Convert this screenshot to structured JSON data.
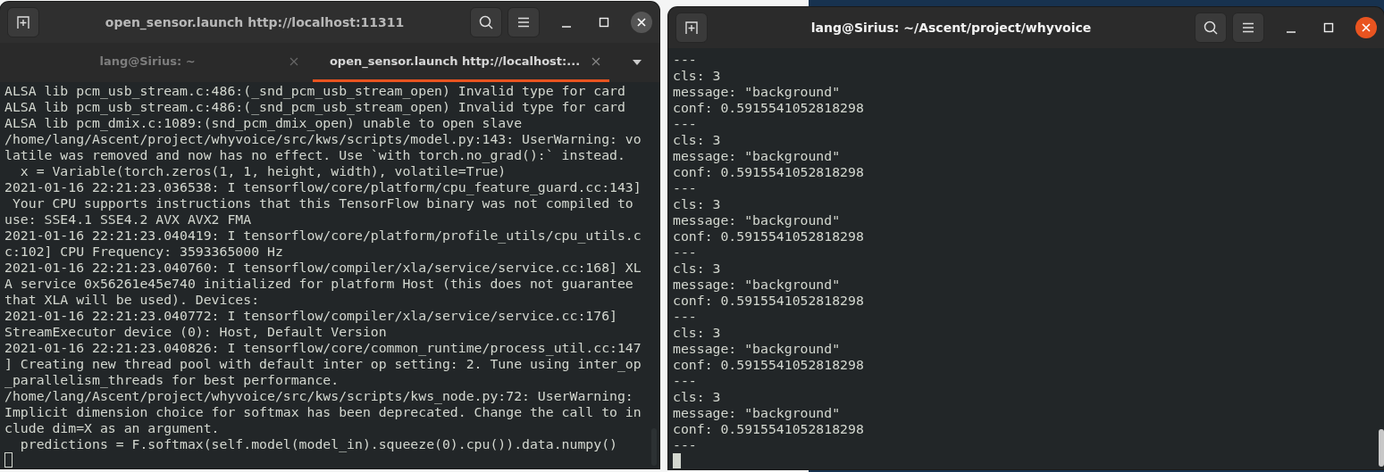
{
  "windows": [
    {
      "title": "open_sensor.launch http://localhost:11311",
      "focused": false,
      "tabs": [
        {
          "label": "lang@Sirius: ~",
          "selected": false
        },
        {
          "label": "open_sensor.launch http://localhost:...",
          "selected": true
        }
      ],
      "lines": [
        "ALSA lib pcm_usb_stream.c:486:(_snd_pcm_usb_stream_open) Invalid type for card",
        "ALSA lib pcm_usb_stream.c:486:(_snd_pcm_usb_stream_open) Invalid type for card",
        "ALSA lib pcm_dmix.c:1089:(snd_pcm_dmix_open) unable to open slave",
        "/home/lang/Ascent/project/whyvoice/src/kws/scripts/model.py:143: UserWarning: vo",
        "latile was removed and now has no effect. Use `with torch.no_grad():` instead.",
        "  x = Variable(torch.zeros(1, 1, height, width), volatile=True)",
        "2021-01-16 22:21:23.036538: I tensorflow/core/platform/cpu_feature_guard.cc:143]",
        " Your CPU supports instructions that this TensorFlow binary was not compiled to",
        "use: SSE4.1 SSE4.2 AVX AVX2 FMA",
        "2021-01-16 22:21:23.040419: I tensorflow/core/platform/profile_utils/cpu_utils.c",
        "c:102] CPU Frequency: 3593365000 Hz",
        "2021-01-16 22:21:23.040760: I tensorflow/compiler/xla/service/service.cc:168] XL",
        "A service 0x56261e45e740 initialized for platform Host (this does not guarantee",
        "that XLA will be used). Devices:",
        "2021-01-16 22:21:23.040772: I tensorflow/compiler/xla/service/service.cc:176]",
        "StreamExecutor device (0): Host, Default Version",
        "2021-01-16 22:21:23.040826: I tensorflow/core/common_runtime/process_util.cc:147",
        "] Creating new thread pool with default inter op setting: 2. Tune using inter_op",
        "_parallelism_threads for best performance.",
        "/home/lang/Ascent/project/whyvoice/src/kws/scripts/kws_node.py:72: UserWarning:",
        "Implicit dimension choice for softmax has been deprecated. Change the call to in",
        "clude dim=X as an argument.",
        "  predictions = F.softmax(self.model(model_in).squeeze(0).cpu()).data.numpy()"
      ]
    },
    {
      "title": "lang@Sirius: ~/Ascent/project/whyvoice",
      "focused": true,
      "lines": [
        "---",
        "cls: 3",
        "message: \"background\"",
        "conf: 0.5915541052818298",
        "---",
        "cls: 3",
        "message: \"background\"",
        "conf: 0.5915541052818298",
        "---",
        "cls: 3",
        "message: \"background\"",
        "conf: 0.5915541052818298",
        "---",
        "cls: 3",
        "message: \"background\"",
        "conf: 0.5915541052818298",
        "---",
        "cls: 3",
        "message: \"background\"",
        "conf: 0.5915541052818298",
        "---",
        "cls: 3",
        "message: \"background\"",
        "conf: 0.5915541052818298",
        "---"
      ]
    }
  ]
}
